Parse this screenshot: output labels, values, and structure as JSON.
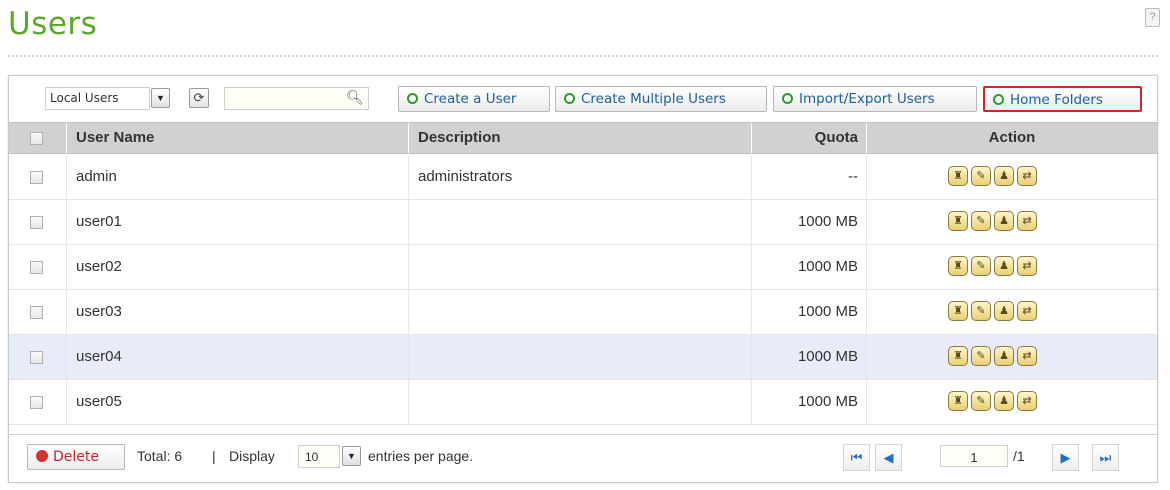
{
  "page": {
    "title": "Users"
  },
  "toolbar": {
    "filter_value": "Local Users",
    "search_value": "",
    "buttons": {
      "create_user": "Create a User",
      "create_multiple": "Create Multiple Users",
      "import_export": "Import/Export Users",
      "home_folders": "Home Folders"
    }
  },
  "table": {
    "headers": {
      "user_name": "User Name",
      "description": "Description",
      "quota": "Quota",
      "action": "Action"
    },
    "rows": [
      {
        "name": "admin",
        "description": "administrators",
        "quota": "--"
      },
      {
        "name": "user01",
        "description": "",
        "quota": "1000 MB"
      },
      {
        "name": "user02",
        "description": "",
        "quota": "1000 MB"
      },
      {
        "name": "user03",
        "description": "",
        "quota": "1000 MB"
      },
      {
        "name": "user04",
        "description": "",
        "quota": "1000 MB"
      },
      {
        "name": "user05",
        "description": "",
        "quota": "1000 MB"
      }
    ]
  },
  "footer": {
    "delete_label": "Delete",
    "total_text": "Total: 6",
    "separator": "|",
    "display_label": "Display",
    "page_size": "10",
    "entries_text": "entries per page.",
    "current_page": "1",
    "total_pages": "/1"
  },
  "icons": {
    "refresh": "refresh-icon",
    "search": "search-icon",
    "add": "add-circle-icon",
    "delete": "delete-circle-icon",
    "row_actions": [
      "quota-icon",
      "edit-icon",
      "group-icon",
      "folder-permission-icon"
    ],
    "pagination": [
      "first-page-icon",
      "prev-page-icon",
      "next-page-icon",
      "last-page-icon"
    ]
  },
  "colors": {
    "title": "#5ca82a",
    "highlight": "#e01e2a",
    "button_text": "#1f5fa0",
    "header_bg": "#d1d1d1",
    "selected_row": "#e8ecf8"
  }
}
